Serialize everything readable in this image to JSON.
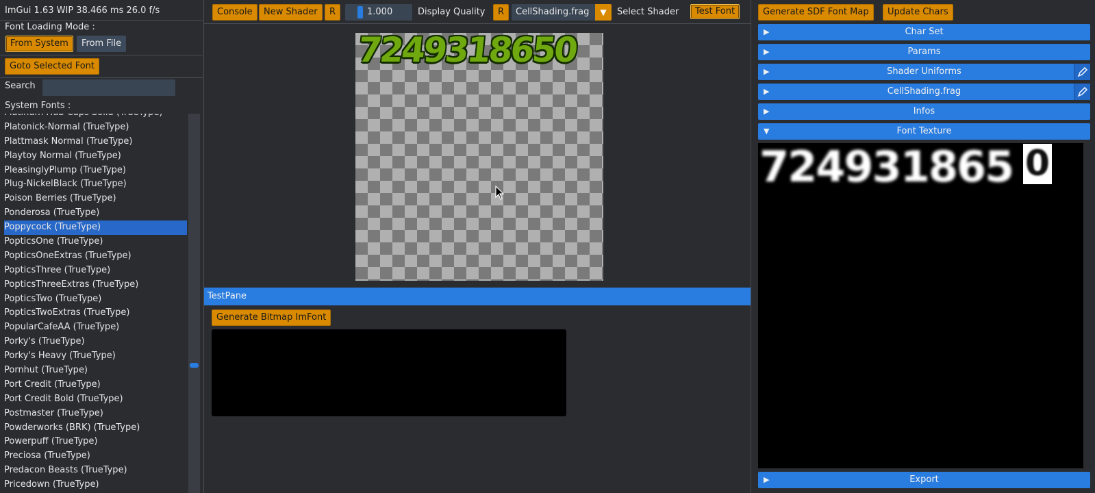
{
  "status": "ImGui 1.63 WIP 38.466 ms 26.0 f/s",
  "left": {
    "font_loading_mode_label": "Font Loading Mode :",
    "from_system": "From System",
    "from_file": "From File",
    "goto_selected": "Goto Selected Font",
    "search_label": "Search",
    "search_value": "",
    "system_fonts_label": "System Fonts :",
    "fonts": [
      "Platinum Hub Caps Solid (TrueType)",
      "Platonick-Normal (TrueType)",
      "Plattmask Normal (TrueType)",
      "Playtoy Normal (TrueType)",
      "PleasinglyPlump (TrueType)",
      "Plug-NickelBlack (TrueType)",
      "Poison Berries (TrueType)",
      "Ponderosa (TrueType)",
      "Poppycock (TrueType)",
      "PopticsOne (TrueType)",
      "PopticsOneExtras (TrueType)",
      "PopticsThree (TrueType)",
      "PopticsThreeExtras (TrueType)",
      "PopticsTwo (TrueType)",
      "PopticsTwoExtras (TrueType)",
      "PopularCafeAA (TrueType)",
      "Porky's (TrueType)",
      "Porky's Heavy (TrueType)",
      "Pornhut (TrueType)",
      "Port Credit (TrueType)",
      "Port Credit Bold (TrueType)",
      "Postmaster (TrueType)",
      "Powderworks (BRK) (TrueType)",
      "Powerpuff (TrueType)",
      "Preciosa (TrueType)",
      "Predacon Beasts (TrueType)",
      "Pricedown (TrueType)"
    ],
    "selected_font": "Poppycock (TrueType)"
  },
  "toolbar": {
    "console": "Console",
    "new_shader": "New Shader",
    "reset_r": "R",
    "quality_value": "1.000",
    "display_quality": "Display Quality",
    "reset_r2": "R",
    "shader_combo": "CellShading.frag",
    "select_shader": "Select Shader",
    "test_font": "Test Font"
  },
  "preview_text": "7249318650",
  "testpane": {
    "title": "TestPane",
    "generate_bitmap": "Generate Bitmap ImFont"
  },
  "right": {
    "generate_sdf": "Generate SDF Font Map",
    "update_chars": "Update Chars",
    "sections": [
      "Char Set",
      "Params",
      "Shader Uniforms",
      "CellShading.frag",
      "Infos",
      "Font Texture"
    ],
    "export": "Export",
    "texture_text": "724931865",
    "texture_last": "0"
  }
}
